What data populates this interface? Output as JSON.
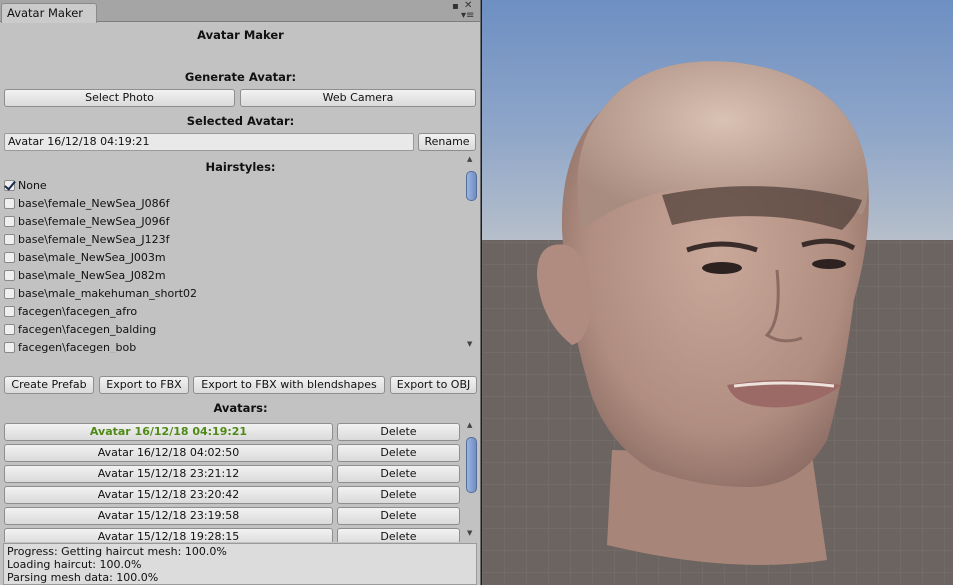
{
  "window": {
    "tab_title": "Avatar Maker",
    "controls": {
      "menu_icon": "kebab-menu-icon",
      "close_icon": "close-icon"
    }
  },
  "panel": {
    "title": "Avatar Maker",
    "generate": {
      "header": "Generate Avatar:",
      "select_photo_label": "Select Photo",
      "web_camera_label": "Web Camera"
    },
    "selected": {
      "header": "Selected Avatar:",
      "name_value": "Avatar 16/12/18 04:19:21",
      "rename_label": "Rename"
    },
    "hairstyles": {
      "header": "Hairstyles:",
      "items": [
        {
          "label": "None",
          "checked": true
        },
        {
          "label": "base\\female_NewSea_J086f",
          "checked": false
        },
        {
          "label": "base\\female_NewSea_J096f",
          "checked": false
        },
        {
          "label": "base\\female_NewSea_J123f",
          "checked": false
        },
        {
          "label": "base\\male_NewSea_J003m",
          "checked": false
        },
        {
          "label": "base\\male_NewSea_J082m",
          "checked": false
        },
        {
          "label": "base\\male_makehuman_short02",
          "checked": false
        },
        {
          "label": "facegen\\facegen_afro",
          "checked": false
        },
        {
          "label": "facegen\\facegen_balding",
          "checked": false
        },
        {
          "label": "facegen\\facegen_bob",
          "checked": false
        }
      ]
    },
    "export": {
      "create_prefab_label": "Create Prefab",
      "export_fbx_label": "Export to FBX",
      "export_fbx_blend_label": "Export to FBX with blendshapes",
      "export_obj_label": "Export to OBJ"
    },
    "avatars": {
      "header": "Avatars:",
      "delete_label": "Delete",
      "items": [
        {
          "name": "Avatar 16/12/18 04:19:21",
          "selected": true
        },
        {
          "name": "Avatar 16/12/18 04:02:50",
          "selected": false
        },
        {
          "name": "Avatar 15/12/18 23:21:12",
          "selected": false
        },
        {
          "name": "Avatar 15/12/18 23:20:42",
          "selected": false
        },
        {
          "name": "Avatar 15/12/18 23:19:58",
          "selected": false
        },
        {
          "name": "Avatar 15/12/18 19:28:15",
          "selected": false
        }
      ]
    },
    "status_lines": [
      "Progress: Getting haircut mesh: 100.0%",
      "Loading haircut: 100.0%",
      "Parsing mesh data: 100.0%"
    ]
  },
  "colors": {
    "panel_bg": "#c2c2c2",
    "selected_avatar_text": "#4f8a16",
    "sky": "#7d9ac6",
    "ground": "#6b6461"
  }
}
